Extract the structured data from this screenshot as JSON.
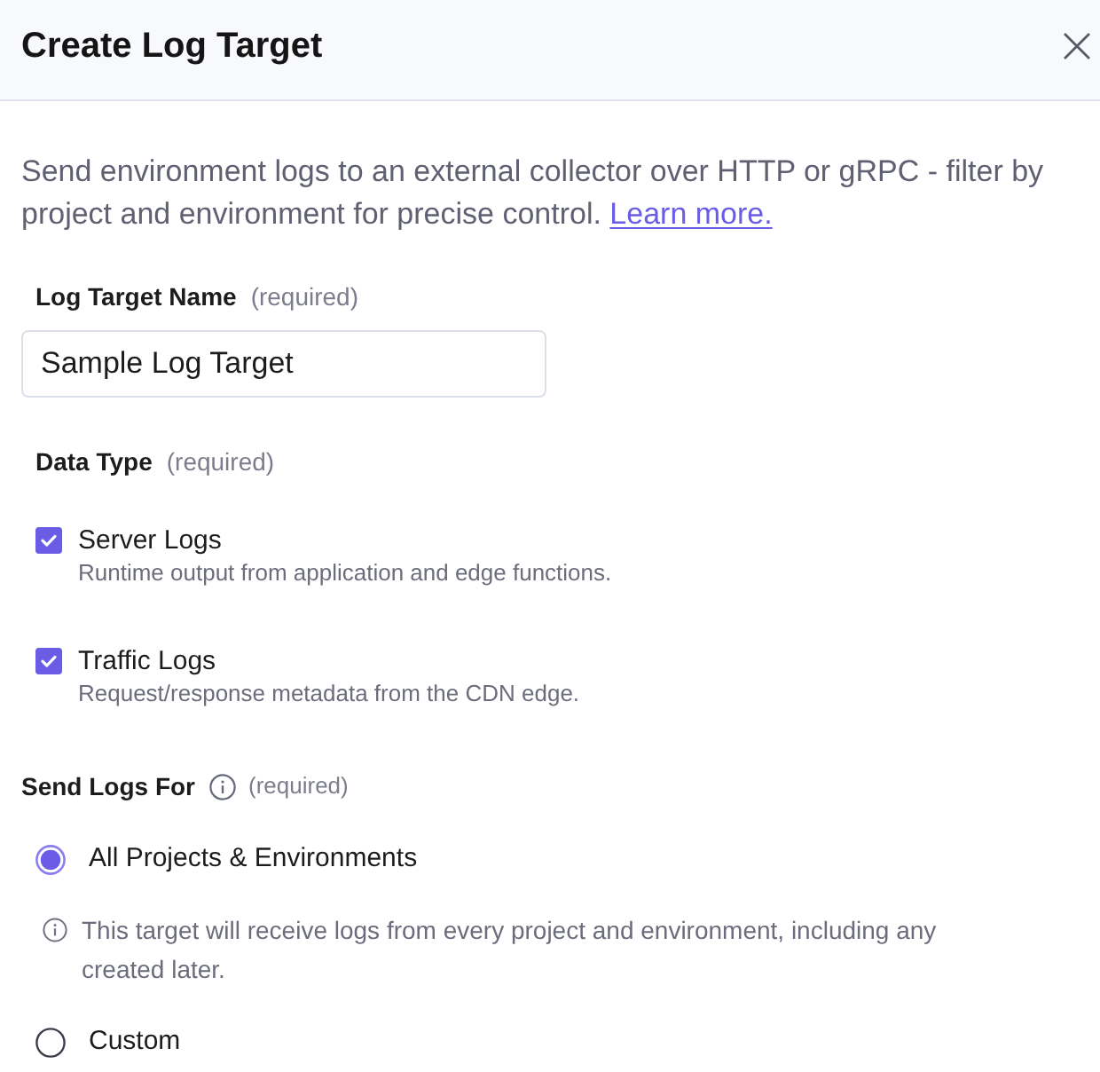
{
  "dialog": {
    "title": "Create Log Target"
  },
  "description": {
    "text": "Send environment logs to an external collector over HTTP or gRPC - filter by project and environment for precise control.",
    "link": "Learn more."
  },
  "name_field": {
    "label": "Log Target Name",
    "hint": "(required)",
    "value": "Sample Log Target"
  },
  "data_type": {
    "label": "Data Type",
    "hint": "(required)",
    "options": [
      {
        "label": "Server Logs",
        "description": "Runtime output from application and edge functions.",
        "checked": true
      },
      {
        "label": "Traffic Logs",
        "description": "Request/response metadata from the CDN edge.",
        "checked": true
      }
    ]
  },
  "send_logs_for": {
    "label": "Send Logs For",
    "hint": "(required)",
    "options": [
      {
        "label": "All Projects & Environments",
        "selected": true,
        "note": "This target will receive logs from every project and environment, including any created later."
      },
      {
        "label": "Custom",
        "selected": false
      }
    ]
  }
}
